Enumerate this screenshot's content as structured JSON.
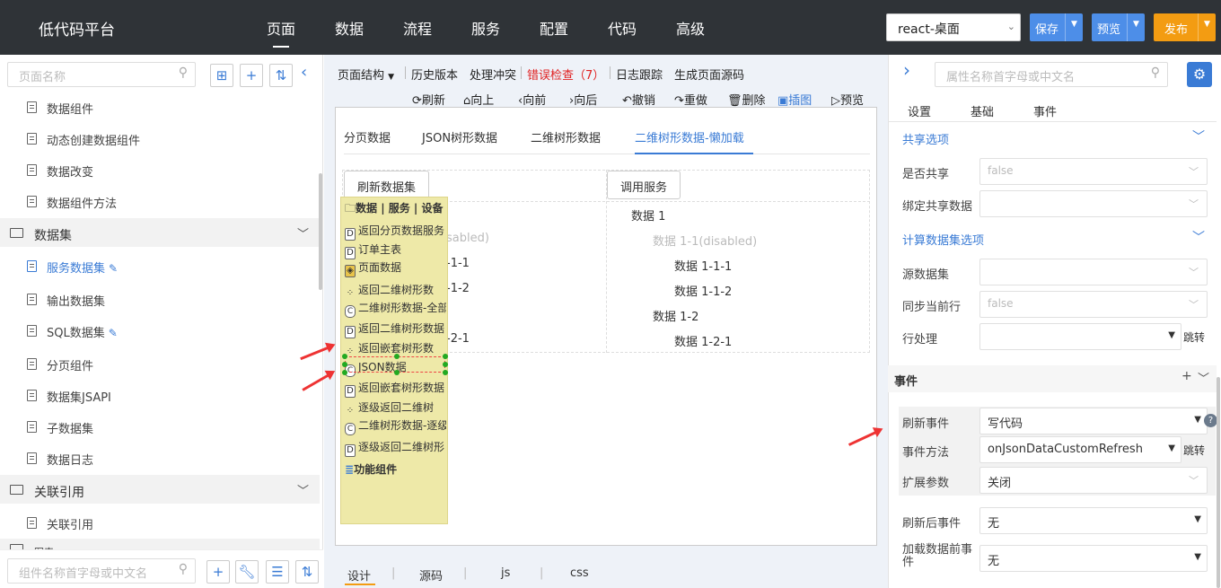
{
  "header": {
    "logo": "低代码平台",
    "nav": [
      "页面",
      "数据",
      "流程",
      "服务",
      "配置",
      "代码",
      "高级"
    ],
    "env": "react-桌面",
    "buttons": {
      "save": "保存",
      "preview": "预览",
      "publish": "发布"
    },
    "colors": {
      "bar": "#2f3337",
      "save": "#4d8ee8",
      "preview": "#4d8ee8",
      "publish": "#f39c12"
    }
  },
  "left": {
    "search_placeholder": "页面名称",
    "bottom_search_placeholder": "组件名称首字母或中文名",
    "items": [
      "数据组件",
      "动态创建数据组件",
      "数据改变",
      "数据组件方法"
    ],
    "group1": "数据集",
    "group1_items": [
      "服务数据集",
      "输出数据集",
      "SQL数据集",
      "分页组件",
      "数据集JSAPI",
      "子数据集",
      "数据日志"
    ],
    "group2": "关联引用",
    "group2_items": [
      "关联引用"
    ],
    "group3": "图表"
  },
  "center": {
    "toolbar": [
      "页面结构",
      "历史版本",
      "处理冲突",
      "错误检查（7）",
      "日志跟踪",
      "生成页面源码"
    ],
    "actions": [
      "刷新",
      "向上",
      "向前",
      "向后",
      "撤销",
      "重做",
      "删除",
      "插图",
      "预览"
    ],
    "tabs": [
      "分页数据",
      "JSON树形数据",
      "二维树形数据",
      "二维树形数据-懒加载"
    ],
    "btn_refresh": "刷新数据集",
    "btn_call": "调用服务",
    "tree_left": [
      "sabled)",
      "-1-1",
      "-1-2",
      "-2-1"
    ],
    "tree_right": [
      "数据 1",
      "数据 1-1(disabled)",
      "数据 1-1-1",
      "数据 1-1-2",
      "数据 1-2",
      "数据 1-2-1"
    ],
    "toolbox_title": "数据 | 服务 | 设备",
    "toolbox": [
      "返回分页数据服务",
      "订单主表",
      "页面数据",
      "返回二维树形数",
      "二维树形数据-全部",
      "返回二维树形数据",
      "返回嵌套树形数",
      "JSON数据",
      "返回嵌套树形数据",
      "逐级返回二维树",
      "二维树形数据-逐级",
      "逐级返回二维树形"
    ],
    "toolbox_footer": "功能组件",
    "bottom_tabs": [
      "设计",
      "源码",
      "js",
      "css"
    ]
  },
  "right": {
    "search_placeholder": "属性名称首字母或中文名",
    "tabs": [
      "设置",
      "基础",
      "事件"
    ],
    "sec_share": "共享选项",
    "lbl_is_share": "是否共享",
    "val_false": "false",
    "lbl_bind_share": "绑定共享数据",
    "sec_calc": "计算数据集选项",
    "lbl_src": "源数据集",
    "lbl_sync": "同步当前行",
    "lbl_row": "行处理",
    "jump": "跳转",
    "sec_event": "事件",
    "lbl_refresh_ev": "刷新事件",
    "val_refresh_ev": "写代码",
    "lbl_ev_method": "事件方法",
    "val_ev_method": "onJsonDataCustomRefresh",
    "lbl_ext": "扩展参数",
    "val_ext": "关闭",
    "lbl_after": "刷新后事件",
    "val_none": "无",
    "lbl_before": "加载数据前事件"
  }
}
